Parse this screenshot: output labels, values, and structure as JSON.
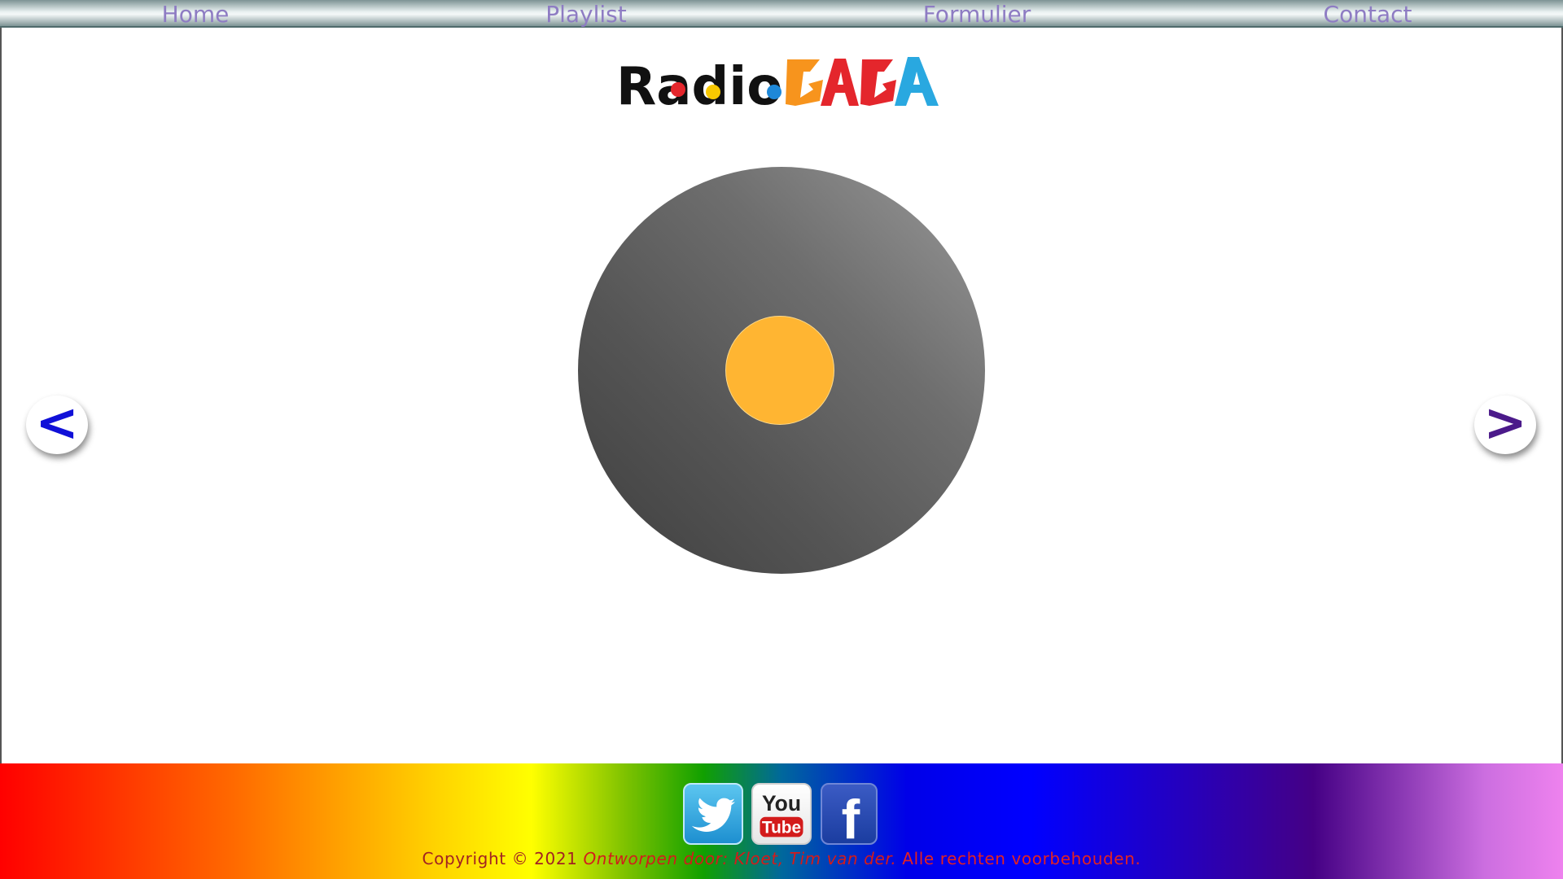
{
  "nav": {
    "items": [
      {
        "label": "Home"
      },
      {
        "label": "Playlist"
      },
      {
        "label": "Formulier"
      },
      {
        "label": "Contact"
      }
    ]
  },
  "logo": {
    "word_radio": "Radio",
    "word_gaga": "GAGA"
  },
  "player": {
    "prev_label": "<",
    "next_label": ">"
  },
  "footer": {
    "social": [
      {
        "name": "Twitter",
        "icon": "twitter-icon"
      },
      {
        "name": "YouTube",
        "icon": "youtube-icon",
        "text_top": "You",
        "text_bottom": "Tube"
      },
      {
        "name": "Facebook",
        "icon": "facebook-icon",
        "text": "f"
      }
    ],
    "copyright_prefix": "Copyright © 2021",
    "copyright_author": "Ontworpen door: Kloet, Tim van der.",
    "copyright_suffix": "Alle rechten voorbehouden."
  },
  "colors": {
    "nav_text": "#8e7cc3",
    "disc_label": "#ffb532",
    "prev_arrow": "#1010d8",
    "next_arrow": "#4b1a8a"
  }
}
